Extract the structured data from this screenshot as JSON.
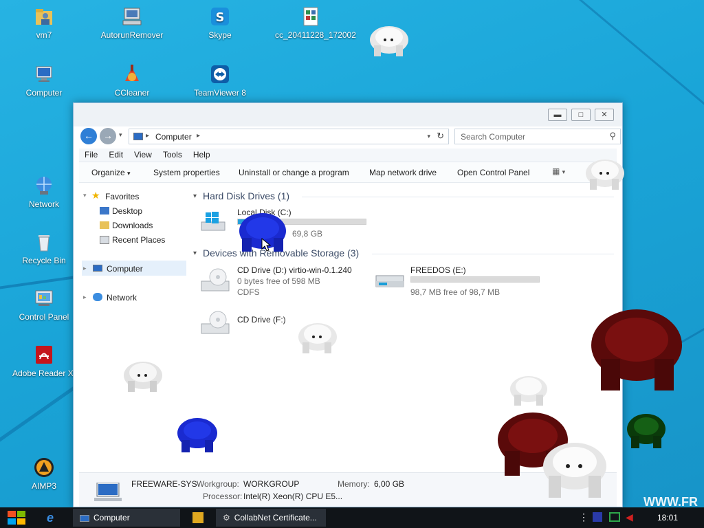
{
  "desktop": {
    "icons": [
      {
        "label": "vm7",
        "icon": "user-folder-icon"
      },
      {
        "label": "AutorunRemover",
        "icon": "computer-tool-icon"
      },
      {
        "label": "Skype",
        "icon": "skype-icon"
      },
      {
        "label": "cc_20411228_172002",
        "icon": "registry-file-icon"
      },
      {
        "label": "Computer",
        "icon": "computer-icon"
      },
      {
        "label": "CCleaner",
        "icon": "ccleaner-icon"
      },
      {
        "label": "TeamViewer 8",
        "icon": "teamviewer-icon"
      },
      {
        "label": "Network",
        "icon": "network-icon"
      },
      {
        "label": "Recycle Bin",
        "icon": "recycle-bin-icon"
      },
      {
        "label": "Control Panel",
        "icon": "control-panel-icon"
      },
      {
        "label": "Adobe Reader XI",
        "icon": "adobe-reader-icon"
      },
      {
        "label": "AIMP3",
        "icon": "aimp-icon"
      }
    ]
  },
  "explorer": {
    "address": {
      "path": "Computer"
    },
    "search": {
      "placeholder": "Search Computer"
    },
    "menu": [
      "File",
      "Edit",
      "View",
      "Tools",
      "Help"
    ],
    "toolbar": [
      "Organize",
      "System properties",
      "Uninstall or change a program",
      "Map network drive",
      "Open Control Panel"
    ],
    "nav": {
      "favorites": "Favorites",
      "items": [
        "Desktop",
        "Downloads",
        "Recent Places"
      ],
      "computer": "Computer",
      "network": "Network"
    },
    "groups": {
      "hdd": "Hard Disk Drives (1)",
      "removable": "Devices with Removable Storage (3)"
    },
    "drives": {
      "c": {
        "name": "Local Disk (C:)",
        "free": "69,8 GB",
        "used_fraction": 0.22
      },
      "d": {
        "name": "CD Drive (D:) virtio-win-0.1.240",
        "free": "0 bytes free of 598 MB",
        "fs": "CDFS"
      },
      "e": {
        "name": "FREEDOS (E:)",
        "free": "98,7 MB free of 98,7 MB",
        "used_fraction": 0.0
      },
      "f": {
        "name": "CD Drive (F:)"
      }
    },
    "details": {
      "name": "FREEWARE-SYS",
      "workgroup_label": "Workgroup:",
      "workgroup": "WORKGROUP",
      "memory_label": "Memory:",
      "memory": "6,00 GB",
      "processor_label": "Processor:",
      "processor": "Intel(R) Xeon(R) CPU E5..."
    }
  },
  "taskbar": {
    "items": [
      "Computer",
      "CollabNet Certificate..."
    ],
    "clock": "18:01"
  },
  "watermark": "WWW.FR",
  "colors": {
    "accent": "#26a0da",
    "taskbar": "#101418",
    "desktop": "#1ba8d8"
  }
}
